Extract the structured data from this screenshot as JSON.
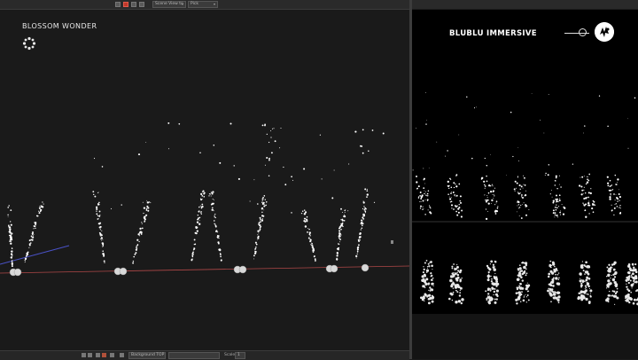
{
  "viewport": {
    "title": "BLOSSOM WONDER",
    "logo_icon": "asterisk-flower-icon"
  },
  "toolbar": {
    "view_dropdown": "Scene View to",
    "mode_dropdown": "Pick"
  },
  "preview": {
    "brand": "BLUBLU IMMERSIVE",
    "slider_icon": "slider-knob-icon",
    "logo_icon": "blublu-logo-icon"
  },
  "statusbar": {
    "operator_field": "Background TOP",
    "scale_label": "Scale",
    "scale_value": "1"
  },
  "colors": {
    "background": "#1a1a1a",
    "preview_header": "#000000",
    "ground_line": "#d05050",
    "pointer_line": "#4a52c8",
    "particles": "#ffffff"
  }
}
